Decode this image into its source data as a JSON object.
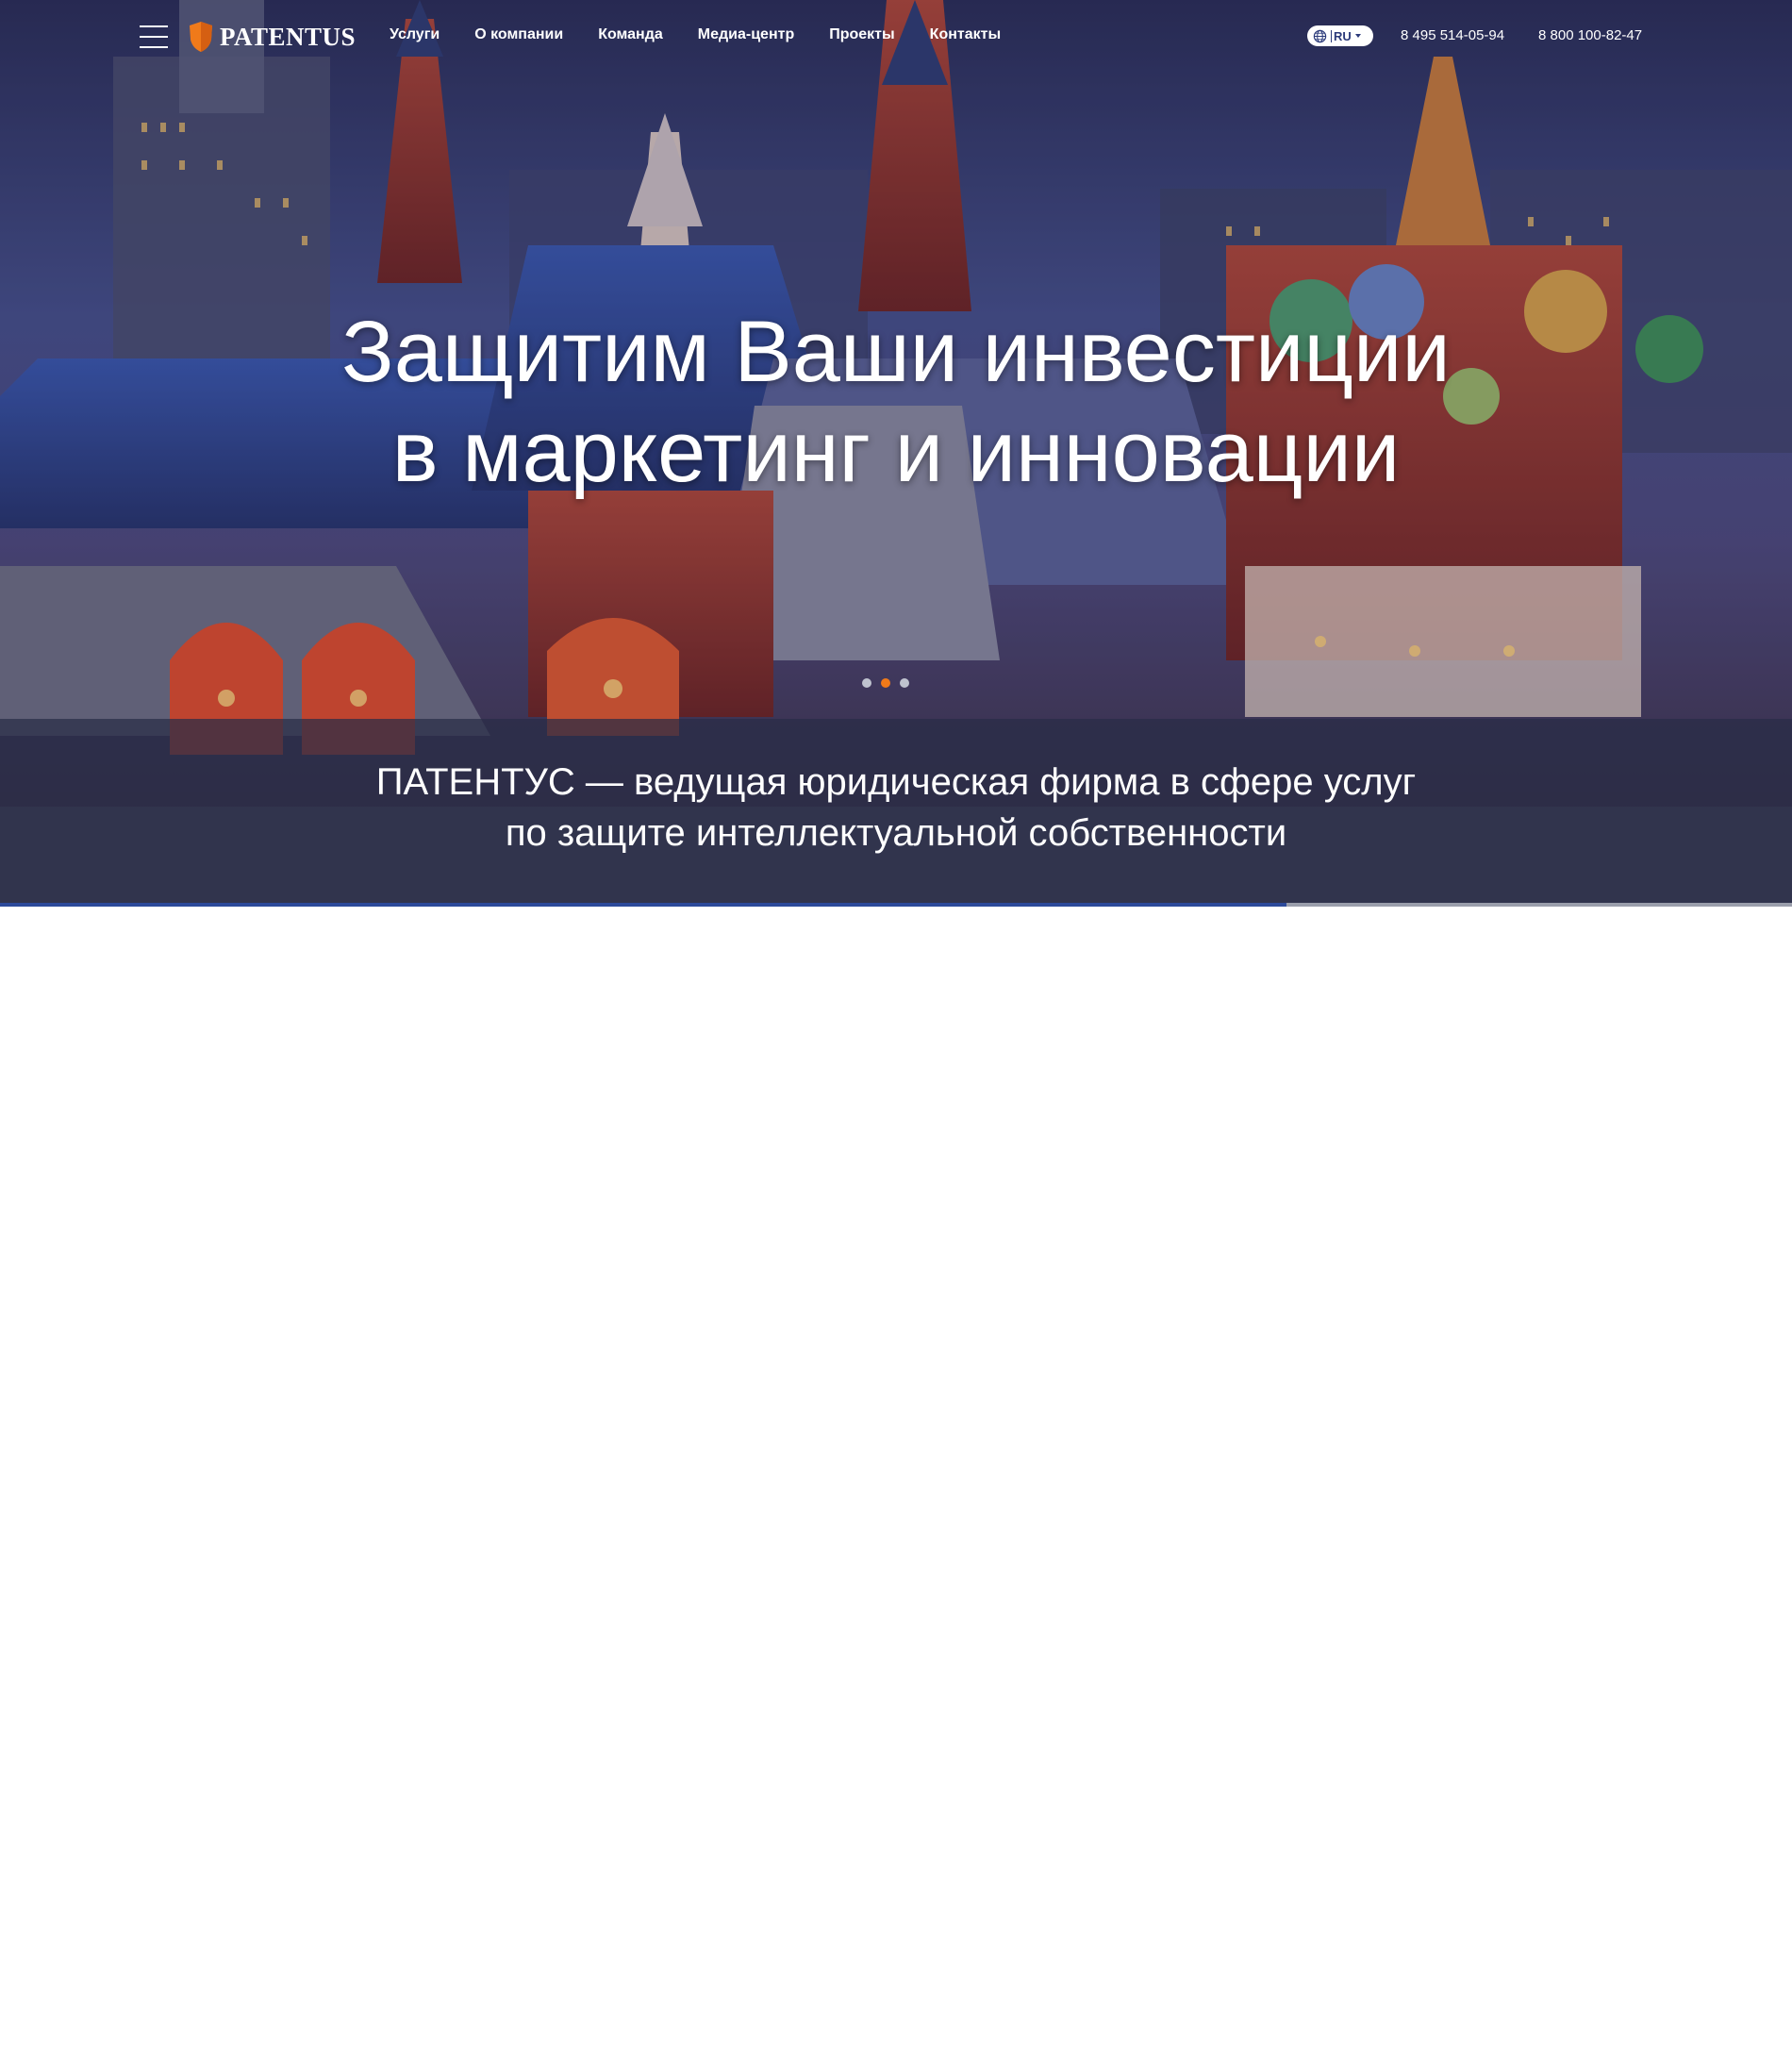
{
  "header": {
    "logo_text": "PATENTUS",
    "nav": [
      {
        "label": "Услуги"
      },
      {
        "label": "О компании"
      },
      {
        "label": "Команда"
      },
      {
        "label": "Медиа-центр"
      },
      {
        "label": "Проекты"
      },
      {
        "label": "Контакты"
      }
    ],
    "language": "RU",
    "phones": [
      "8 495 514-05-94",
      "8 800 100-82-47"
    ]
  },
  "hero": {
    "headline_line1": "Защитим Ваши инвестиции",
    "headline_line2": "в маркетинг и инновации",
    "slider": {
      "count": 3,
      "active_index": 1
    },
    "tagline_line1": "ПАТЕНТУС — ведущая юридическая фирма в сфере услуг",
    "tagline_line2": "по защите интеллектуальной собственности",
    "slide_progress": 0.718
  },
  "colors": {
    "accent": "#f07a1a",
    "brand_blue": "#2c4a9a",
    "band": "#31344d"
  },
  "icons": {
    "menu": "hamburger-menu-icon",
    "logo": "shield-logo-icon",
    "language": "globe-icon"
  }
}
